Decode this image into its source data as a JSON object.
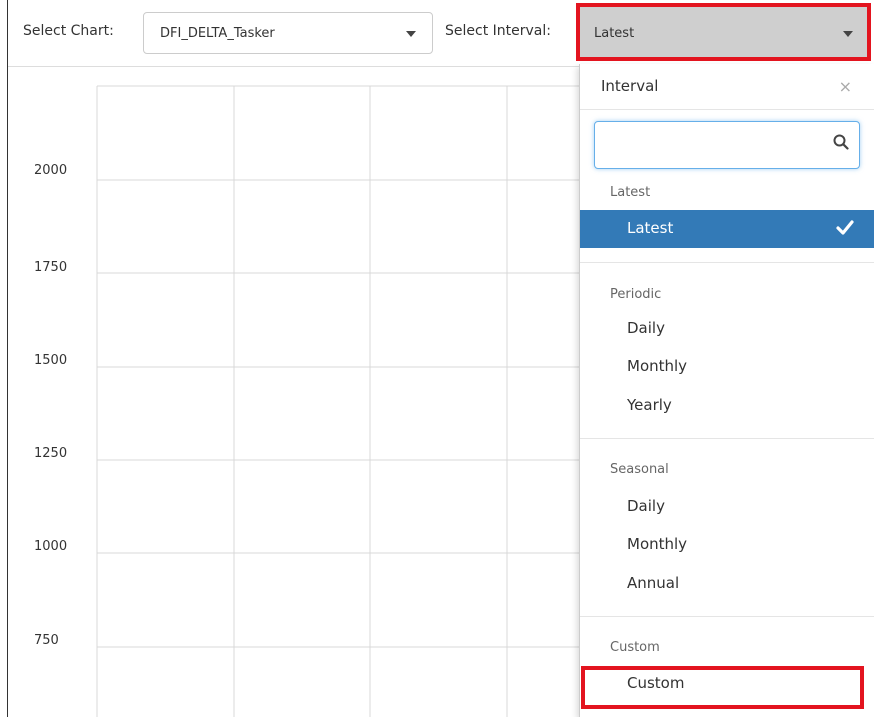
{
  "toolbar": {
    "chart_label": "Select Chart:",
    "chart_value": "DFI_DELTA_Tasker",
    "interval_label": "Select Interval:",
    "interval_value": "Latest"
  },
  "chart_data": {
    "type": "line",
    "y_ticks": [
      "2000",
      "1750",
      "1500",
      "1250",
      "1000",
      "750"
    ],
    "grid": true,
    "series": []
  },
  "dropdown": {
    "title": "Interval",
    "close_glyph": "×",
    "search_placeholder": "",
    "groups": [
      {
        "label": "Latest",
        "options": [
          "Latest"
        ]
      },
      {
        "label": "Periodic",
        "options": [
          "Daily",
          "Monthly",
          "Yearly"
        ]
      },
      {
        "label": "Seasonal",
        "options": [
          "Daily",
          "Monthly",
          "Annual"
        ]
      },
      {
        "label": "Custom",
        "options": [
          "Custom"
        ]
      }
    ],
    "selected": "Latest"
  },
  "icons": {
    "search": "search-icon",
    "check": "check-icon",
    "caret": "chevron-down-icon"
  },
  "colors": {
    "highlight": "#e3141f",
    "selected_bg": "#337ab7",
    "select_bg": "#cfcfcf"
  }
}
